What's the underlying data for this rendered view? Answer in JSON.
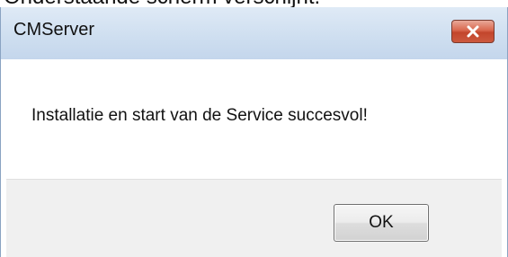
{
  "window": {
    "title": "CMServer",
    "close_icon": "close-icon"
  },
  "dialog": {
    "message": "Installatie en start van de Service succesvol!",
    "ok_label": "OK"
  },
  "page_caption": "Onderstaande scherm verschijnt:",
  "colors": {
    "titlebar": "#cfdff0",
    "close_button": "#c3452c",
    "button_area": "#f0f0f0"
  }
}
